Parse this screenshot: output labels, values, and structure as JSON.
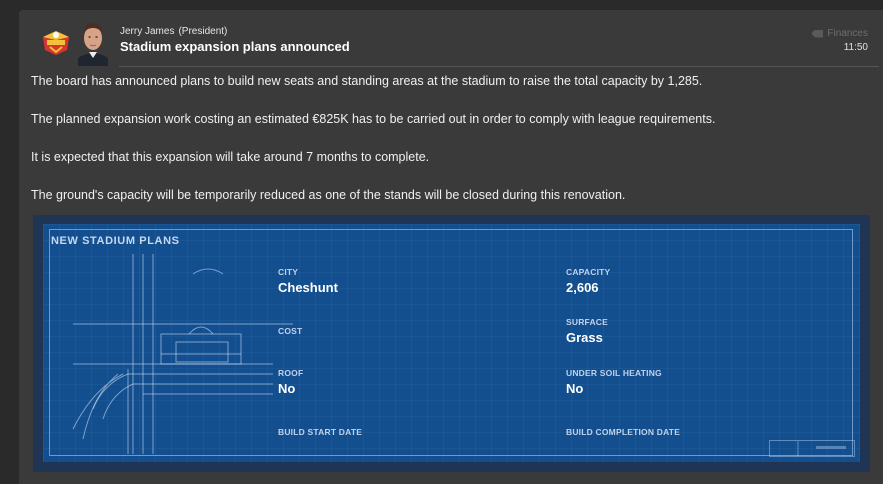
{
  "message": {
    "sender_name": "Jerry James",
    "sender_role": "(President)",
    "subject": "Stadium expansion plans announced",
    "category": "Finances",
    "time": "11:50",
    "paragraphs": [
      "The board has announced plans to build new seats and standing areas at the stadium to raise the total capacity by 1,285.",
      "The planned expansion work costing an estimated €825K has to be carried out in order to comply with league requirements.",
      "It is expected that this expansion will take around 7 months to complete.",
      "The ground's capacity will be temporarily reduced as one of the stands will be closed during this renovation."
    ]
  },
  "plans": {
    "title": "NEW STADIUM PLANS",
    "city_label": "CITY",
    "city_value": "Cheshunt",
    "capacity_label": "CAPACITY",
    "capacity_value": "2,606",
    "cost_label": "COST",
    "cost_value": "",
    "surface_label": "SURFACE",
    "surface_value": "Grass",
    "roof_label": "ROOF",
    "roof_value": "No",
    "heating_label": "UNDER SOIL HEATING",
    "heating_value": "No",
    "start_label": "BUILD START DATE",
    "start_value": "",
    "completion_label": "BUILD COMPLETION DATE",
    "completion_value": ""
  },
  "icons": {
    "crest": "club-crest-icon",
    "avatar": "president-avatar",
    "category": "tag-icon"
  },
  "colors": {
    "background": "#2a2a2a",
    "panel": "#3a3a3a",
    "blueprint": "#134f8f"
  }
}
